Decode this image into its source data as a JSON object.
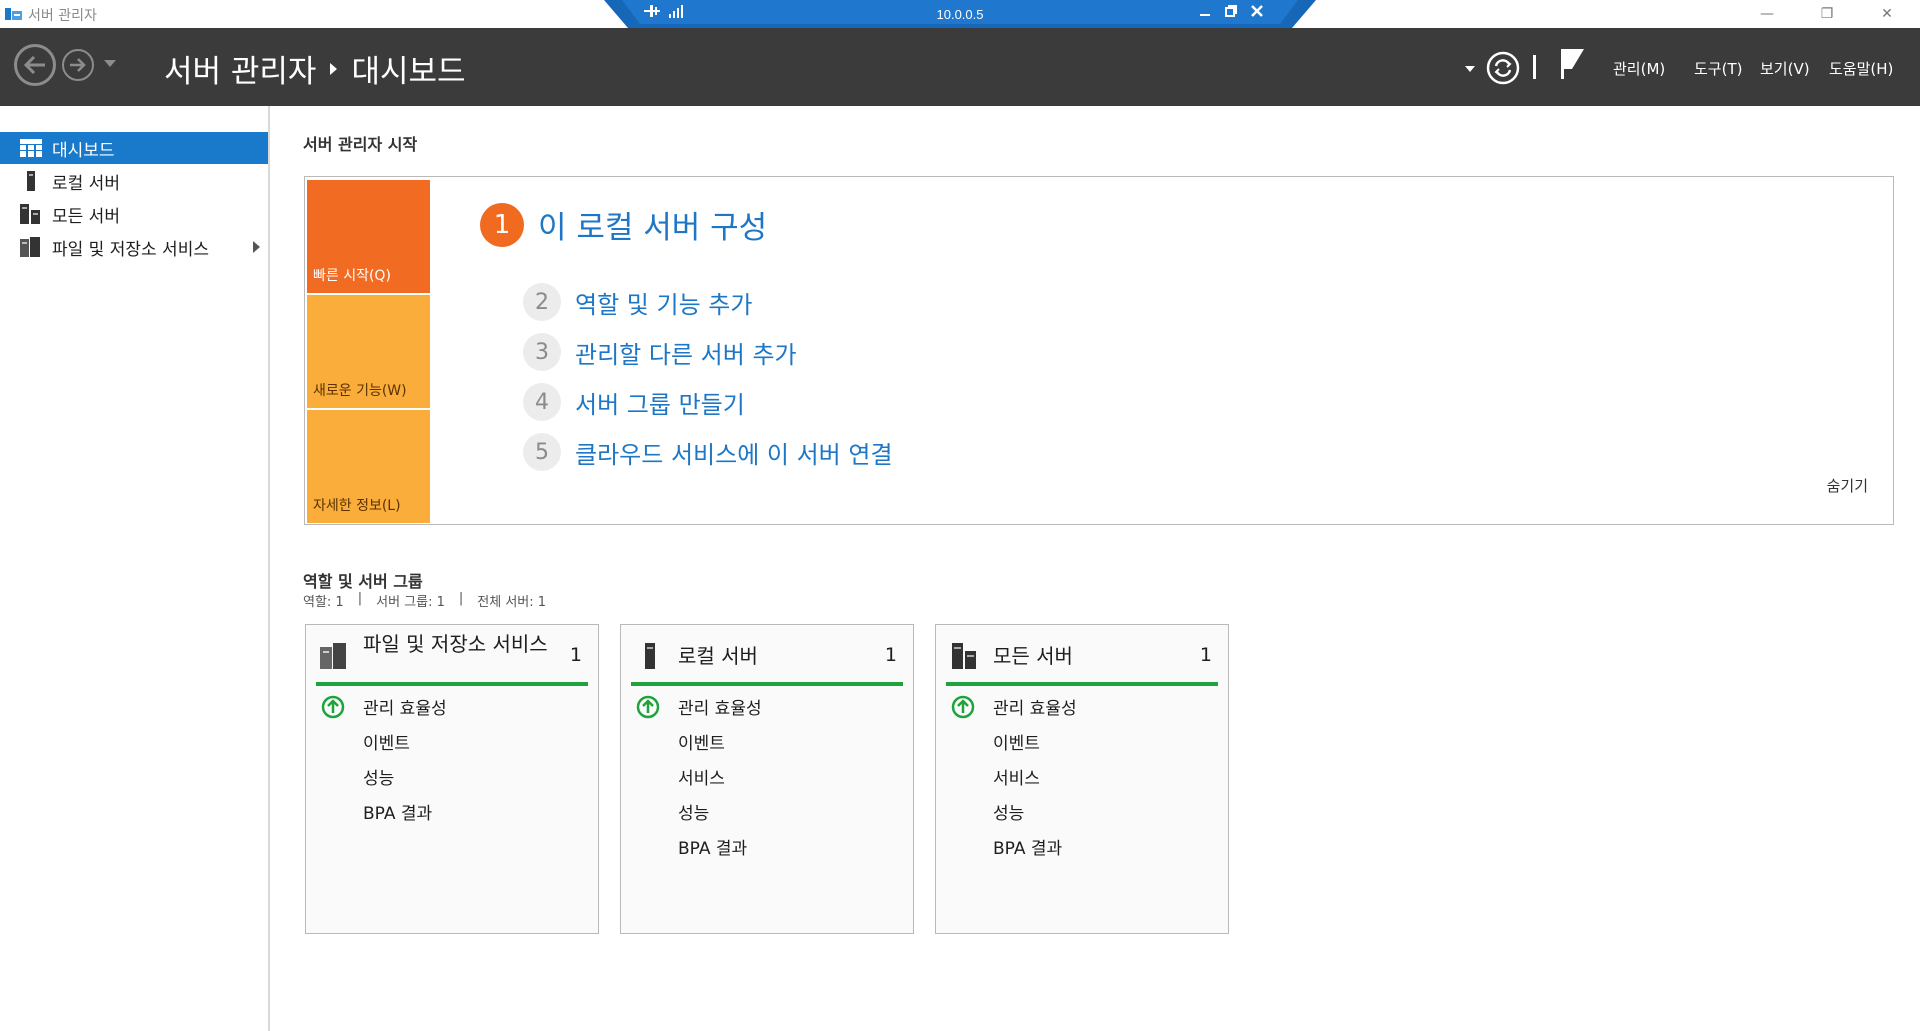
{
  "window": {
    "title": "서버 관리자",
    "controls": {
      "minimize": "—",
      "restore": "❐",
      "close": "✕"
    }
  },
  "rdp_bar": {
    "title": "10.0.0.5"
  },
  "header": {
    "breadcrumb_root": "서버 관리자",
    "breadcrumb_current": "대시보드",
    "menu": {
      "manage": "관리(M)",
      "tools": "도구(T)",
      "view": "보기(V)",
      "help": "도움말(H)"
    }
  },
  "sidebar": {
    "items": [
      {
        "label": "대시보드",
        "icon": "dashboard-icon",
        "active": true
      },
      {
        "label": "로컬 서버",
        "icon": "server-icon"
      },
      {
        "label": "모든 서버",
        "icon": "servers-icon"
      },
      {
        "label": "파일 및 저장소 서비스",
        "icon": "file-storage-icon",
        "has_children": true
      }
    ]
  },
  "welcome": {
    "title": "서버 관리자 시작",
    "tiles": {
      "quick_start": "빠른 시작(Q)",
      "whats_new": "새로운 기능(W)",
      "learn_more": "자세한 정보(L)"
    },
    "steps": [
      {
        "num": "1",
        "label": "이 로컬 서버 구성"
      },
      {
        "num": "2",
        "label": "역할 및 기능 추가"
      },
      {
        "num": "3",
        "label": "관리할 다른 서버 추가"
      },
      {
        "num": "4",
        "label": "서버 그룹 만들기"
      },
      {
        "num": "5",
        "label": "클라우드 서비스에 이 서버 연결"
      }
    ],
    "hide": "숨기기"
  },
  "roles": {
    "title": "역할 및 서버 그룹",
    "stats": {
      "roles": "역할: 1",
      "sep1": "|",
      "groups": "서버 그룹: 1",
      "sep2": "|",
      "total": "전체 서버: 1"
    },
    "cards": [
      {
        "title": "파일 및 저장소 서비스",
        "count": "1",
        "rows": [
          "관리 효율성",
          "이벤트",
          "성능",
          "BPA 결과"
        ]
      },
      {
        "title": "로컬 서버",
        "count": "1",
        "rows": [
          "관리 효율성",
          "이벤트",
          "서비스",
          "성능",
          "BPA 결과"
        ]
      },
      {
        "title": "모든 서버",
        "count": "1",
        "rows": [
          "관리 효율성",
          "이벤트",
          "서비스",
          "성능",
          "BPA 결과"
        ]
      }
    ],
    "status_color": "#1fa33c"
  },
  "colors": {
    "header_bg": "#3b3b3b",
    "accent_blue": "#1979ca",
    "link_blue": "#1e77c6",
    "orange": "#f16b22",
    "amber": "#fbad3b"
  }
}
